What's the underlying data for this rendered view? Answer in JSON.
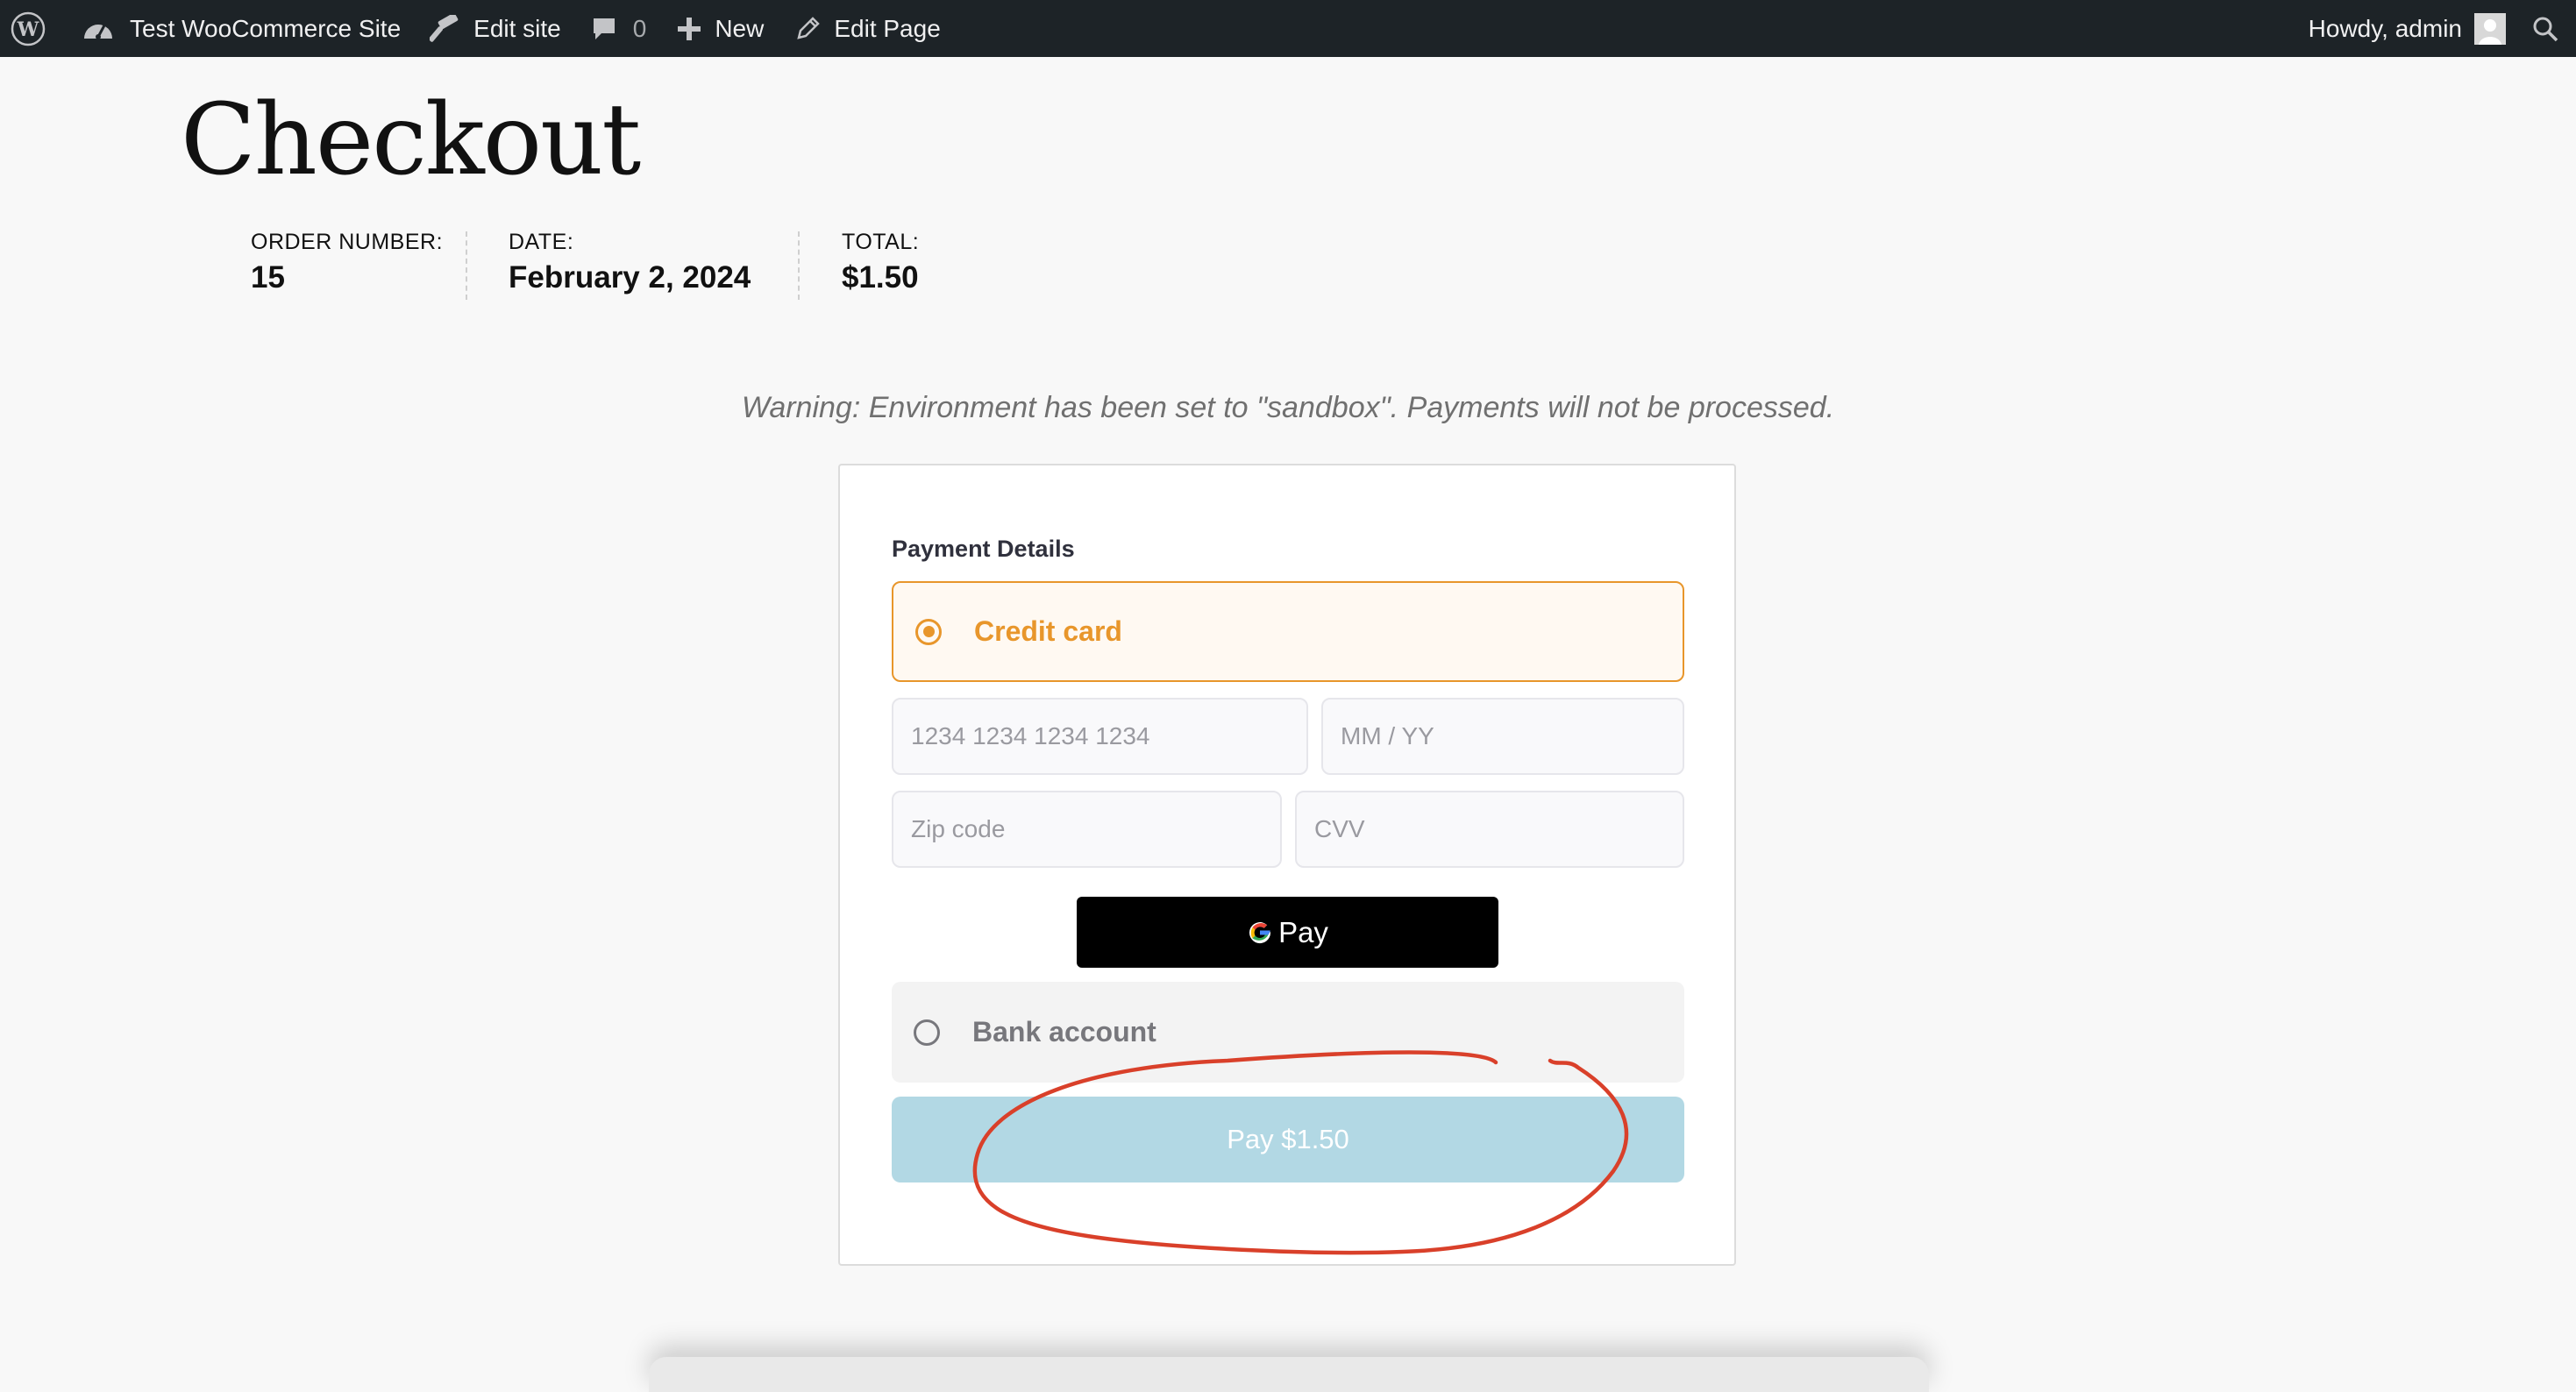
{
  "admin_bar": {
    "wp_logo": "wordpress-logo",
    "site_name": "Test WooCommerce Site",
    "edit_site": "Edit site",
    "comments_count": "0",
    "new_label": "New",
    "edit_page": "Edit Page",
    "greeting": "Howdy, admin"
  },
  "page": {
    "title": "Checkout"
  },
  "order": {
    "number_label": "ORDER NUMBER:",
    "number_value": "15",
    "date_label": "DATE:",
    "date_value": "February 2, 2024",
    "total_label": "TOTAL:",
    "total_value": "$1.50"
  },
  "warning": "Warning: Environment has been set to \"sandbox\". Payments will not be processed.",
  "payment": {
    "section_title": "Payment Details",
    "methods": [
      {
        "label": "Credit card",
        "selected": true
      },
      {
        "label": "Bank account",
        "selected": false
      }
    ],
    "card_number_placeholder": "1234 1234 1234 1234",
    "expiry_placeholder": "MM / YY",
    "zip_placeholder": "Zip code",
    "cvv_placeholder": "CVV",
    "gpay_label": "Pay",
    "pay_button": "Pay $1.50"
  },
  "colors": {
    "admin_bar": "#1d2327",
    "accent": "#e8962b",
    "pay_button": "#b2d8e4",
    "annotation": "#d9402a"
  }
}
